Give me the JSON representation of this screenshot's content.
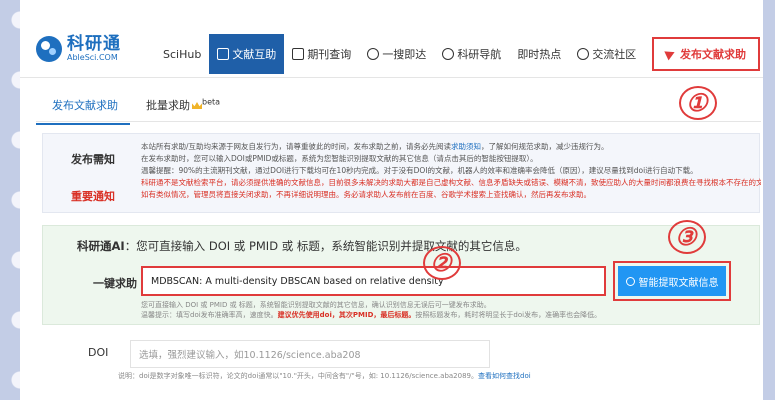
{
  "logo": {
    "title": "科研通",
    "subtitle": "AbleSci.COM"
  },
  "nav": [
    {
      "label": "SciHub"
    },
    {
      "label": "文献互助"
    },
    {
      "label": "期刊查询"
    },
    {
      "label": "一搜即达"
    },
    {
      "label": "科研导航"
    },
    {
      "label": "即时热点"
    },
    {
      "label": "交流社区"
    }
  ],
  "header": {
    "publish_label": "发布文献求助"
  },
  "tabs": [
    {
      "label": "发布文献求助"
    },
    {
      "label": "批量求助",
      "badge": "beta"
    }
  ],
  "notice": {
    "label_publish": "发布需知",
    "label_important": "重要通知",
    "line1_a": "本站所有求助/互助均来源于网友自发行为，请尊重彼此的时间，发布求助之前，请务必先阅读",
    "line1_link": "求助须知",
    "line1_b": "，了解如何规范求助，减少违规行为。",
    "line2": "在发布求助时，您可以输入DOI或PMID或标题，系统为您智能识别提取文献的其它信息（请点击其后的智能按钮提取）。",
    "line3": "温馨提醒：90%的主流期刊文献，通过DOI进行下载均可在10秒内完成。对于没有DOI的文献，机器人的效率和准确率会降低（原因），建议尽量找到doi进行自动下载。",
    "line4": "科研通不是文献检索平台，请必须提供准确的文献信息，目前很多未解决的求助大都是自己虚构文献、信息矛盾缺失或错误、模糊不清，致使应助人的大量时间都浪费在寻找根本不存在的文献上。",
    "line5": "如有类似情况，管理员将直接关闭求助，不再详细说明理由。务必请求助人发布前在百度、谷歌学术搜索上查找确认，然后再发布求助。"
  },
  "ai": {
    "heading_name": "科研通AI",
    "heading_text": "：您可直接输入 DOI 或 PMID 或 标题，系统智能识别并提取文献的其它信息。",
    "oneclick_label": "一键求助",
    "input_value": "MDBSCAN: A multi-density DBSCAN based on relative density",
    "button_label": "智能提取文献信息",
    "tip1": "您可直接输入 DOI 或 PMID 或 标题，系统智能识别提取文献的其它信息，确认识别信息无误后可一键发布求助。",
    "tip2_a": "温馨提示：填写doi发布准确率高，速度快。",
    "tip2_b": "建议优先使用doi，其次PMID，最后标题。",
    "tip2_c": "按照标题发布，耗时将明显长于doi发布，准确率也会降低。"
  },
  "doi": {
    "label": "DOI",
    "placeholder": "选填，强烈建议输入，如10.1126/science.aba208",
    "tip": "说明：doi是数字对象唯一标识符，论文的doi通常以\"10.\"开头，中间含有\"/\"号，如: 10.1126/science.aba2089。",
    "tip_link": "查看如何查找doi"
  },
  "annotations": [
    "①",
    "②",
    "③"
  ],
  "colors": {
    "brand_blue": "#1e6fbf",
    "nav_active": "#1f5fa8",
    "button_blue": "#2196f3",
    "alert_red": "#d93025",
    "annotation_red": "#e03b3b"
  }
}
